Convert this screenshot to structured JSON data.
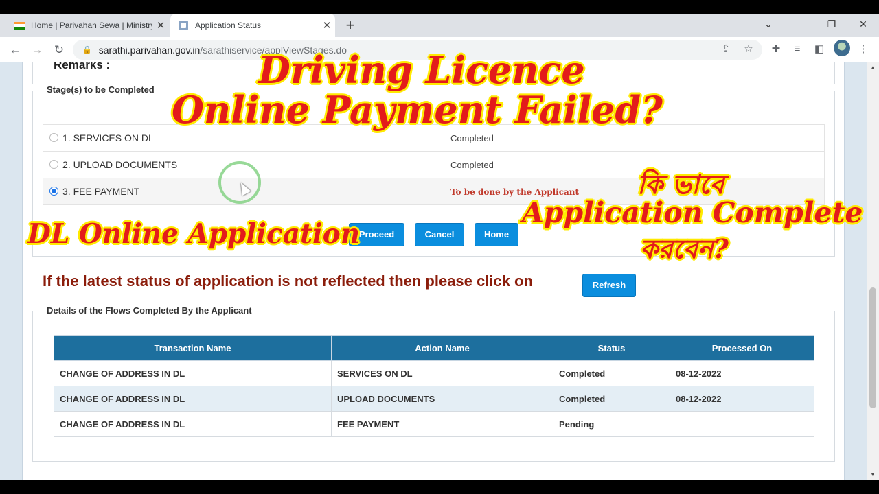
{
  "browser": {
    "tabs": [
      {
        "title": "Home | Parivahan Sewa | Ministry"
      },
      {
        "title": "Application Status"
      }
    ],
    "new_tab": "+",
    "url": {
      "host": "sarathi.parivahan.gov.in",
      "path": "/sarathiservice/applViewStages.do"
    }
  },
  "page": {
    "remarks_label": "Remarks :",
    "stages_legend": "Stage(s) to be Completed",
    "stages": [
      {
        "label": "1.  SERVICES ON DL",
        "status": "Completed",
        "selected": false
      },
      {
        "label": "2.  UPLOAD DOCUMENTS",
        "status": "Completed",
        "selected": false
      },
      {
        "label": "3.  FEE PAYMENT",
        "status": "To be done by the Applicant",
        "selected": true
      }
    ],
    "buttons": {
      "proceed": "Proceed",
      "cancel": "Cancel",
      "home": "Home",
      "refresh": "Refresh"
    },
    "notice": "If the latest status of application is not reflected then please click on",
    "flows_legend": "Details of the Flows Completed By the Applicant",
    "flows_table": {
      "headers": [
        "Transaction Name",
        "Action Name",
        "Status",
        "Processed On"
      ],
      "rows": [
        [
          "CHANGE OF ADDRESS IN DL",
          "SERVICES ON DL",
          "Completed",
          "08-12-2022"
        ],
        [
          "CHANGE OF ADDRESS IN DL",
          "UPLOAD DOCUMENTS",
          "Completed",
          "08-12-2022"
        ],
        [
          "CHANGE OF ADDRESS IN DL",
          "FEE PAYMENT",
          "Pending",
          ""
        ]
      ]
    }
  },
  "overlay": {
    "line1": "Driving Licence",
    "line2": "Online Payment Failed?",
    "left_caption": "DL Online Application",
    "bengali_top": "কি ভাবে",
    "right_caption": "Application Complete",
    "bengali_bottom": "করবেন?"
  },
  "colors": {
    "accent_button": "#0b8ede",
    "table_header": "#1d6f9e",
    "notice_text": "#8b1d0b",
    "overlay_text": "#e31b1b",
    "overlay_outline": "#ffea00"
  }
}
